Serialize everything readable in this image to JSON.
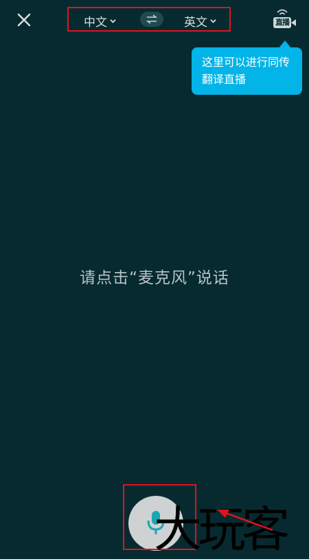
{
  "header": {
    "source_language": "中文",
    "target_language": "英文",
    "live_label": "直播"
  },
  "tooltip": {
    "line1": "这里可以进行同传",
    "line2": "翻译直播"
  },
  "main": {
    "hint": "请点击“麦克风”说话"
  },
  "watermark": {
    "text": "大玩客"
  },
  "colors": {
    "background": "#062a2f",
    "tooltip": "#02b4e8",
    "highlight": "#e0141e",
    "mic_accent": "#1aa6b4"
  }
}
